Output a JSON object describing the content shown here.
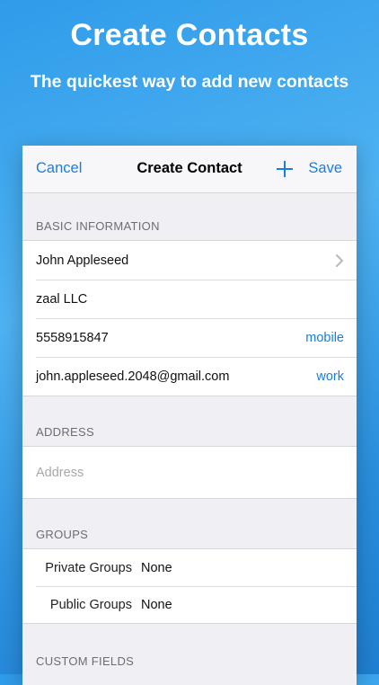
{
  "promo": {
    "title": "Create Contacts",
    "subtitle": "The quickest way to add new contacts"
  },
  "nav": {
    "cancel": "Cancel",
    "title": "Create Contact",
    "plus_icon": "plus-icon",
    "save": "Save"
  },
  "sections": {
    "basic": {
      "header": "BASIC INFORMATION",
      "name": "John Appleseed",
      "company": "zaal LLC",
      "phone": "5558915847",
      "phone_type": "mobile",
      "email": "john.appleseed.2048@gmail.com",
      "email_type": "work"
    },
    "address": {
      "header": "ADDRESS",
      "placeholder": "Address"
    },
    "groups": {
      "header": "GROUPS",
      "private_label": "Private Groups",
      "private_value": "None",
      "public_label": "Public Groups",
      "public_value": "None"
    },
    "custom": {
      "header": "CUSTOM FIELDS"
    }
  },
  "colors": {
    "accent": "#1a7ee0",
    "background": "#2f9bea"
  }
}
